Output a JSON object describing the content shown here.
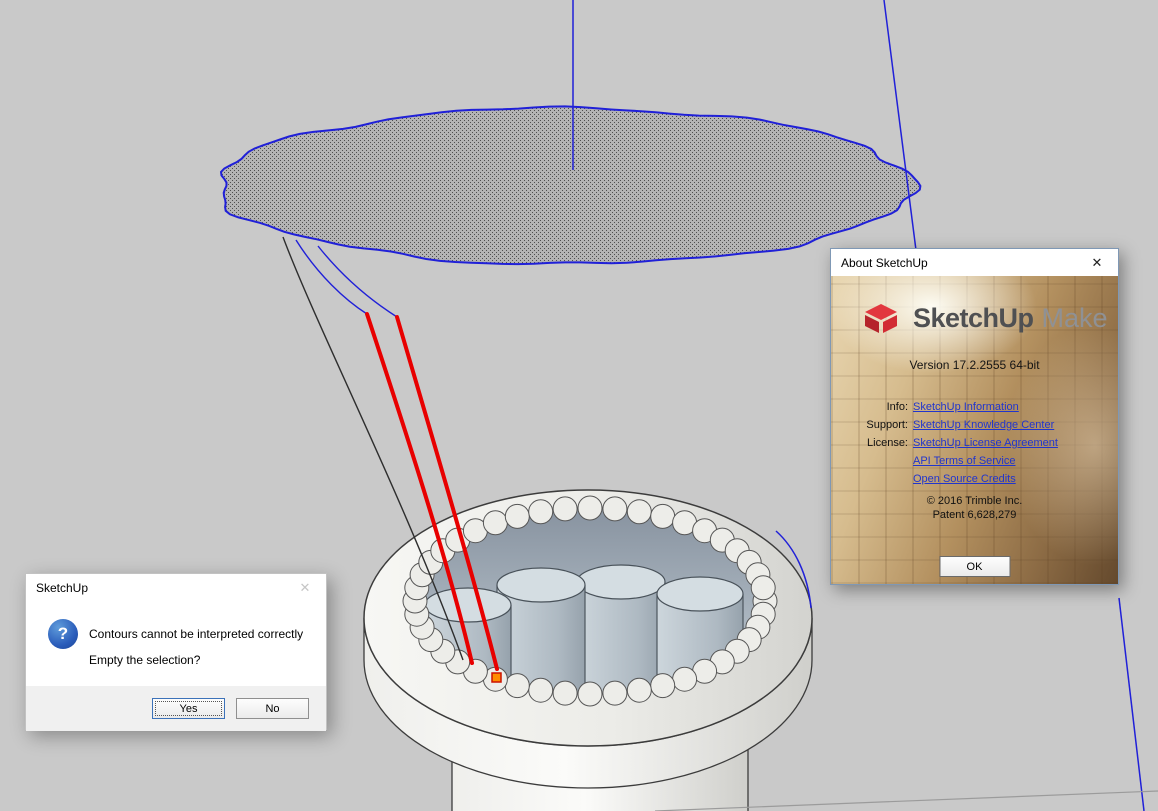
{
  "viewport": {
    "bg": "#c9c9c9"
  },
  "colors": {
    "viewport_bg": "#c9c9c9",
    "selection_blue": "#2020d8",
    "curve_red": "#e80000",
    "logo_red": "#d6252e",
    "link_blue": "#2135cd",
    "focus_blue": "#3c72b9"
  },
  "about_dialog": {
    "title": "About SketchUp",
    "close": "✕",
    "brand": "SketchUp",
    "brand_suffix": "Make",
    "version": "Version 17.2.2555 64-bit",
    "rows": [
      {
        "label": "Info:",
        "link": "SketchUp Information"
      },
      {
        "label": "Support:",
        "link": "SketchUp Knowledge Center"
      },
      {
        "label": "License:",
        "link": "SketchUp License Agreement"
      },
      {
        "label": "",
        "link": "API Terms of Service"
      },
      {
        "label": "",
        "link": "Open Source Credits"
      }
    ],
    "copyright": "© 2016 Trimble Inc.",
    "patent": "Patent 6,628,279",
    "ok": "OK"
  },
  "message_dialog": {
    "title": "SketchUp",
    "close": "✕",
    "line1": "Contours cannot be interpreted correctly",
    "line2": "Empty the selection?",
    "yes": "Yes",
    "no": "No"
  }
}
